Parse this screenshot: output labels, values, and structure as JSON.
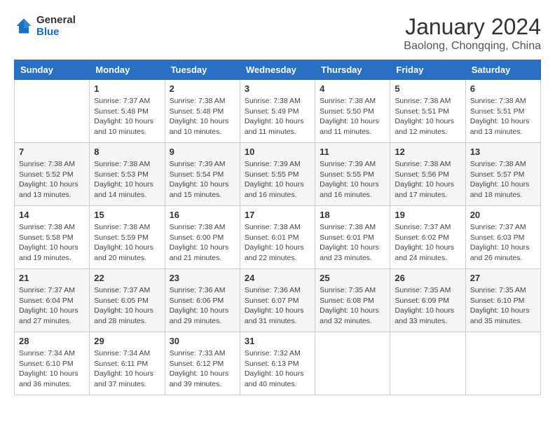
{
  "header": {
    "logo_line1": "General",
    "logo_line2": "Blue",
    "month": "January 2024",
    "location": "Baolong, Chongqing, China"
  },
  "weekdays": [
    "Sunday",
    "Monday",
    "Tuesday",
    "Wednesday",
    "Thursday",
    "Friday",
    "Saturday"
  ],
  "weeks": [
    [
      {
        "day": "",
        "info": ""
      },
      {
        "day": "1",
        "info": "Sunrise: 7:37 AM\nSunset: 5:48 PM\nDaylight: 10 hours\nand 10 minutes."
      },
      {
        "day": "2",
        "info": "Sunrise: 7:38 AM\nSunset: 5:48 PM\nDaylight: 10 hours\nand 10 minutes."
      },
      {
        "day": "3",
        "info": "Sunrise: 7:38 AM\nSunset: 5:49 PM\nDaylight: 10 hours\nand 11 minutes."
      },
      {
        "day": "4",
        "info": "Sunrise: 7:38 AM\nSunset: 5:50 PM\nDaylight: 10 hours\nand 11 minutes."
      },
      {
        "day": "5",
        "info": "Sunrise: 7:38 AM\nSunset: 5:51 PM\nDaylight: 10 hours\nand 12 minutes."
      },
      {
        "day": "6",
        "info": "Sunrise: 7:38 AM\nSunset: 5:51 PM\nDaylight: 10 hours\nand 13 minutes."
      }
    ],
    [
      {
        "day": "7",
        "info": "Sunrise: 7:38 AM\nSunset: 5:52 PM\nDaylight: 10 hours\nand 13 minutes."
      },
      {
        "day": "8",
        "info": "Sunrise: 7:38 AM\nSunset: 5:53 PM\nDaylight: 10 hours\nand 14 minutes."
      },
      {
        "day": "9",
        "info": "Sunrise: 7:39 AM\nSunset: 5:54 PM\nDaylight: 10 hours\nand 15 minutes."
      },
      {
        "day": "10",
        "info": "Sunrise: 7:39 AM\nSunset: 5:55 PM\nDaylight: 10 hours\nand 16 minutes."
      },
      {
        "day": "11",
        "info": "Sunrise: 7:39 AM\nSunset: 5:55 PM\nDaylight: 10 hours\nand 16 minutes."
      },
      {
        "day": "12",
        "info": "Sunrise: 7:38 AM\nSunset: 5:56 PM\nDaylight: 10 hours\nand 17 minutes."
      },
      {
        "day": "13",
        "info": "Sunrise: 7:38 AM\nSunset: 5:57 PM\nDaylight: 10 hours\nand 18 minutes."
      }
    ],
    [
      {
        "day": "14",
        "info": "Sunrise: 7:38 AM\nSunset: 5:58 PM\nDaylight: 10 hours\nand 19 minutes."
      },
      {
        "day": "15",
        "info": "Sunrise: 7:38 AM\nSunset: 5:59 PM\nDaylight: 10 hours\nand 20 minutes."
      },
      {
        "day": "16",
        "info": "Sunrise: 7:38 AM\nSunset: 6:00 PM\nDaylight: 10 hours\nand 21 minutes."
      },
      {
        "day": "17",
        "info": "Sunrise: 7:38 AM\nSunset: 6:01 PM\nDaylight: 10 hours\nand 22 minutes."
      },
      {
        "day": "18",
        "info": "Sunrise: 7:38 AM\nSunset: 6:01 PM\nDaylight: 10 hours\nand 23 minutes."
      },
      {
        "day": "19",
        "info": "Sunrise: 7:37 AM\nSunset: 6:02 PM\nDaylight: 10 hours\nand 24 minutes."
      },
      {
        "day": "20",
        "info": "Sunrise: 7:37 AM\nSunset: 6:03 PM\nDaylight: 10 hours\nand 26 minutes."
      }
    ],
    [
      {
        "day": "21",
        "info": "Sunrise: 7:37 AM\nSunset: 6:04 PM\nDaylight: 10 hours\nand 27 minutes."
      },
      {
        "day": "22",
        "info": "Sunrise: 7:37 AM\nSunset: 6:05 PM\nDaylight: 10 hours\nand 28 minutes."
      },
      {
        "day": "23",
        "info": "Sunrise: 7:36 AM\nSunset: 6:06 PM\nDaylight: 10 hours\nand 29 minutes."
      },
      {
        "day": "24",
        "info": "Sunrise: 7:36 AM\nSunset: 6:07 PM\nDaylight: 10 hours\nand 31 minutes."
      },
      {
        "day": "25",
        "info": "Sunrise: 7:35 AM\nSunset: 6:08 PM\nDaylight: 10 hours\nand 32 minutes."
      },
      {
        "day": "26",
        "info": "Sunrise: 7:35 AM\nSunset: 6:09 PM\nDaylight: 10 hours\nand 33 minutes."
      },
      {
        "day": "27",
        "info": "Sunrise: 7:35 AM\nSunset: 6:10 PM\nDaylight: 10 hours\nand 35 minutes."
      }
    ],
    [
      {
        "day": "28",
        "info": "Sunrise: 7:34 AM\nSunset: 6:10 PM\nDaylight: 10 hours\nand 36 minutes."
      },
      {
        "day": "29",
        "info": "Sunrise: 7:34 AM\nSunset: 6:11 PM\nDaylight: 10 hours\nand 37 minutes."
      },
      {
        "day": "30",
        "info": "Sunrise: 7:33 AM\nSunset: 6:12 PM\nDaylight: 10 hours\nand 39 minutes."
      },
      {
        "day": "31",
        "info": "Sunrise: 7:32 AM\nSunset: 6:13 PM\nDaylight: 10 hours\nand 40 minutes."
      },
      {
        "day": "",
        "info": ""
      },
      {
        "day": "",
        "info": ""
      },
      {
        "day": "",
        "info": ""
      }
    ]
  ]
}
